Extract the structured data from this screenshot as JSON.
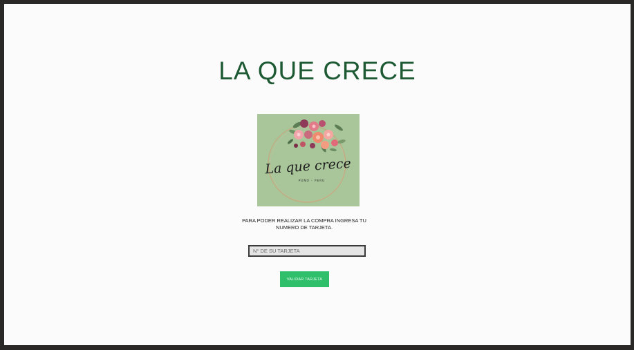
{
  "page": {
    "title": "LA QUE CRECE"
  },
  "logo": {
    "script_text": "La que crece",
    "subtext": "PUNO - PERU"
  },
  "form": {
    "instructions": "PARA PODER REALIZAR LA COMPRA INGRESA TU NUMERO DE TARJETA.",
    "card_placeholder": "N° DE SU TARJETA",
    "card_value": "",
    "submit_label": "VALIDAR TARJETA"
  },
  "colors": {
    "title": "#1d5a34",
    "button": "#2fbf6a",
    "logo_background": "#a9c69a",
    "frame": "#2a2727"
  }
}
